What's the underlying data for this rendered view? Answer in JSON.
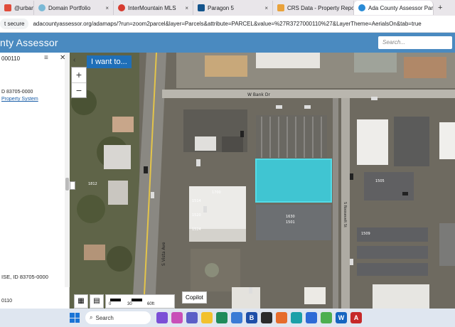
{
  "browser": {
    "tabs": [
      {
        "label": "@urban",
        "color": "#e04b3a"
      },
      {
        "label": "Domain Portfolio",
        "color": "#7ab9d6"
      },
      {
        "label": "InterMountain MLS",
        "color": "#d63b2f"
      },
      {
        "label": "Paragon 5",
        "color": "#14548c"
      },
      {
        "label": "CRS Data - Property Report",
        "color": "#e9a23b"
      },
      {
        "label": "Ada County Assessor Parcel",
        "color": "#2a8bd6",
        "active": true
      }
    ],
    "tab_close": "×",
    "new_tab": "+",
    "secure_label": "t secure",
    "url": "adacountyassessor.org/adamaps/?run=zoom2parcel&layer=Parcels&attribute=PARCEL&value=%27R3727000110%27&LayerTheme=AerialsOn&tab=true"
  },
  "app": {
    "title": "nty Assessor",
    "search_placeholder": "Search..."
  },
  "panel": {
    "parcel_id": "000110",
    "menu_icon": "≡",
    "close_icon": "✕",
    "zip_line": "D 83705-0000",
    "link": "Property System",
    "address_line": "ISE, ID 83705-0000",
    "bottom_id": "0110"
  },
  "map": {
    "i_want_to": "I want to...",
    "back": "‹",
    "zoom_in": "+",
    "zoom_out": "−",
    "copilot": "Copilot",
    "scale": {
      "t0": "0",
      "t1": "30",
      "t2": "60ft"
    },
    "streets": {
      "bank": "W Bank Dr",
      "vista": "S Vista Ave",
      "right": "S Roosevelt St"
    },
    "labels": {
      "l1": "1812",
      "l2": "1816",
      "l3": "1514",
      "l4": "1520",
      "l5": "1524",
      "l6": "1528",
      "l7": "1700",
      "l8": "1810",
      "l9": "1630",
      "l10": "1501",
      "l11": "1505",
      "l12": "1509"
    },
    "parcel_fill": "#38d6e6",
    "parcel_stroke": "#4ff0ff"
  },
  "taskbar": {
    "left_text": "",
    "search_label": "Search",
    "apps": [
      "🌐",
      "🦋",
      "📁",
      "📧",
      "✉",
      "🌀",
      "🛡",
      "B",
      "■",
      "🦊",
      "🌐",
      "🟢",
      "e",
      "W",
      "A"
    ]
  }
}
